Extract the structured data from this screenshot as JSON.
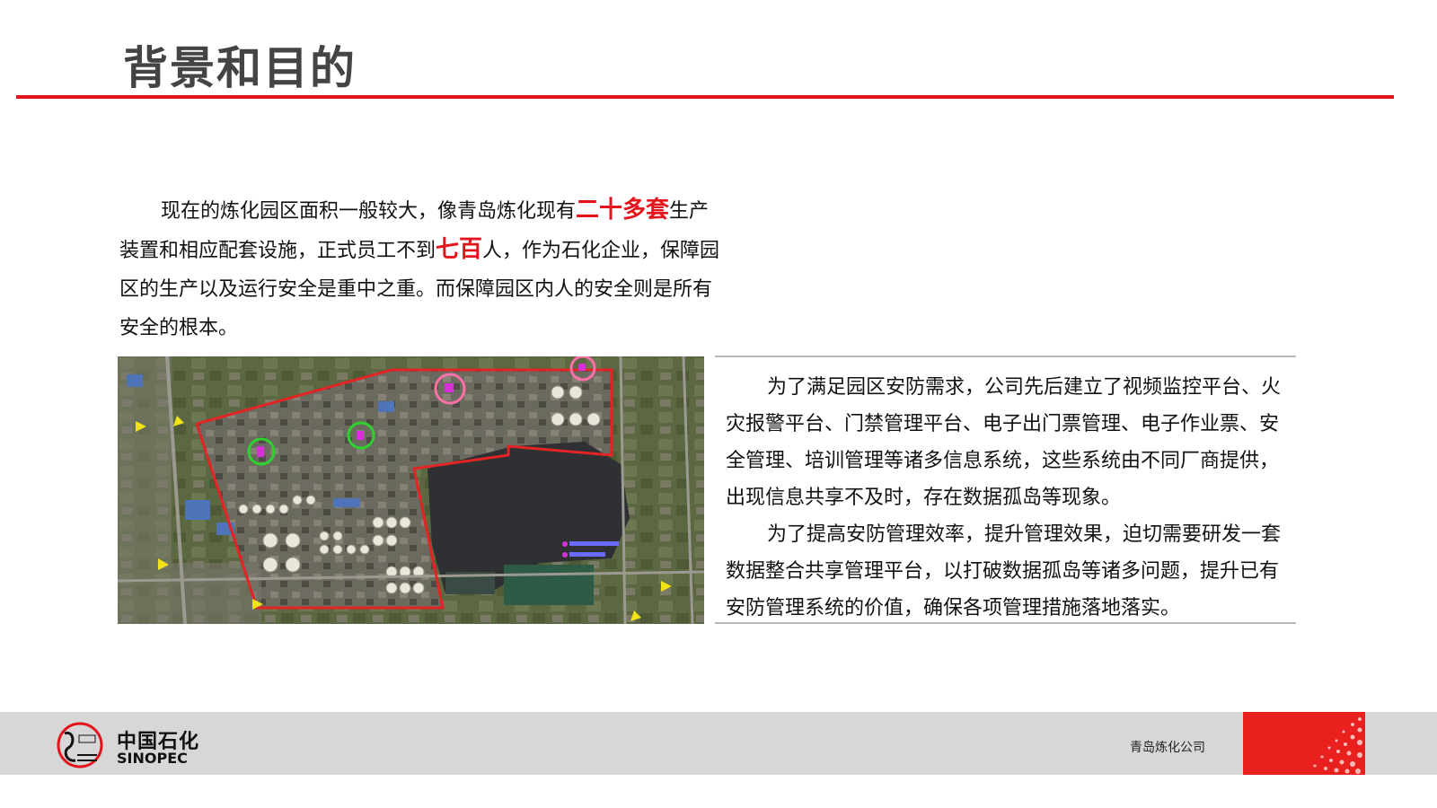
{
  "slide": {
    "title": "背景和目的"
  },
  "intro": {
    "part1": "现在的炼化园区面积一般较大，像青岛炼化现有",
    "highlight1": "二十多套",
    "part2": "生产装置和相应配套设施，正式员工不到",
    "highlight2": "七百",
    "part3": "人，作为石化企业，保障园区的生产以及运行安全是重中之重。而保障园区内人的安全则是所有安全的根本。"
  },
  "map": {
    "description_icon": "satellite-map-image"
  },
  "purpose": {
    "para1": "为了满足园区安防需求，公司先后建立了视频监控平台、火灾报警平台、门禁管理平台、电子出门票管理、电子作业票、安全管理、培训管理等诸多信息系统，这些系统由不同厂商提供，出现信息共享不及时，存在数据孤岛等现象。",
    "para2": "为了提高安防管理效率，提升管理效果，迫切需要研发一套数据整合共享管理平台，以打破数据孤岛等诸多问题，提升已有安防管理系统的价值，确保各项管理措施落地落实。"
  },
  "footer": {
    "brand_cn": "中国石化",
    "brand_en": "SINOPEC",
    "company": "青岛炼化公司"
  },
  "colors": {
    "accent": "#e3141b",
    "title": "#444444",
    "footer_bg": "#d7d7d7"
  }
}
